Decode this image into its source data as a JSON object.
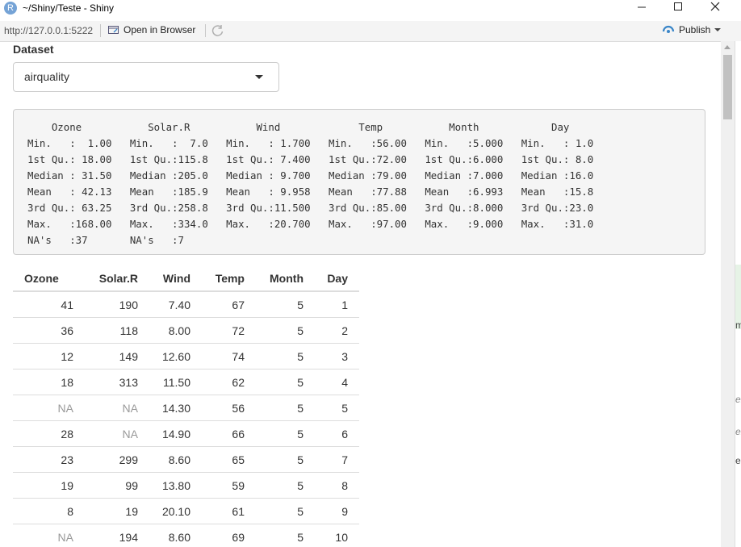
{
  "window": {
    "title": "~/Shiny/Teste - Shiny",
    "logo_letter": "R",
    "minimize": "—",
    "maximize": "☐",
    "close": "✕"
  },
  "toolbar": {
    "url": "http://127.0.0.1:5222",
    "open_browser": "Open in Browser",
    "publish": "Publish"
  },
  "dataset": {
    "label": "Dataset",
    "selected": "airquality"
  },
  "summary_text": "    Ozone           Solar.R           Wind             Temp           Month            Day      \nMin.   :  1.00   Min.   :  7.0   Min.   : 1.700   Min.   :56.00   Min.   :5.000   Min.   : 1.0  \n1st Qu.: 18.00   1st Qu.:115.8   1st Qu.: 7.400   1st Qu.:72.00   1st Qu.:6.000   1st Qu.: 8.0  \nMedian : 31.50   Median :205.0   Median : 9.700   Median :79.00   Median :7.000   Median :16.0  \nMean   : 42.13   Mean   :185.9   Mean   : 9.958   Mean   :77.88   Mean   :6.993   Mean   :15.8  \n3rd Qu.: 63.25   3rd Qu.:258.8   3rd Qu.:11.500   3rd Qu.:85.00   3rd Qu.:8.000   3rd Qu.:23.0  \nMax.   :168.00   Max.   :334.0   Max.   :20.700   Max.   :97.00   Max.   :9.000   Max.   :31.0  \nNA's   :37       NA's   :7                                                                       ",
  "table": {
    "headers": [
      "Ozone",
      "Solar.R",
      "Wind",
      "Temp",
      "Month",
      "Day"
    ],
    "rows": [
      [
        "41",
        "190",
        "7.40",
        "67",
        "5",
        "1"
      ],
      [
        "36",
        "118",
        "8.00",
        "72",
        "5",
        "2"
      ],
      [
        "12",
        "149",
        "12.60",
        "74",
        "5",
        "3"
      ],
      [
        "18",
        "313",
        "11.50",
        "62",
        "5",
        "4"
      ],
      [
        "NA",
        "NA",
        "14.30",
        "56",
        "5",
        "5"
      ],
      [
        "28",
        "NA",
        "14.90",
        "66",
        "5",
        "6"
      ],
      [
        "23",
        "299",
        "8.60",
        "65",
        "5",
        "7"
      ],
      [
        "19",
        "99",
        "13.80",
        "59",
        "5",
        "8"
      ],
      [
        "8",
        "19",
        "20.10",
        "61",
        "5",
        "9"
      ],
      [
        "NA",
        "194",
        "8.60",
        "69",
        "5",
        "10"
      ]
    ]
  },
  "background_glyphs": [
    "m",
    "er",
    "er",
    "eg"
  ],
  "colors": {
    "accent": "#3a86c8",
    "na_text": "#999999"
  }
}
